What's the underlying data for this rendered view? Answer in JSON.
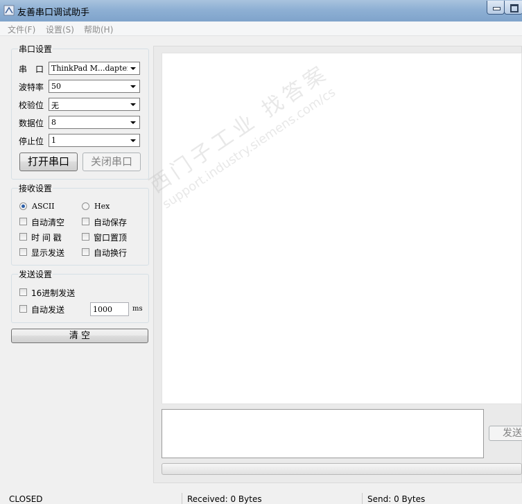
{
  "window": {
    "title": "友善串口调试助手"
  },
  "menu": {
    "items": [
      "文件(F)",
      "设置(S)",
      "帮助(H)"
    ]
  },
  "serial_settings": {
    "title": "串口设置",
    "port_label": "串　口",
    "port_value": "ThinkPad M...dapter",
    "baud_label": "波特率",
    "baud_value": "50",
    "parity_label": "校验位",
    "parity_value": "无",
    "databits_label": "数据位",
    "databits_value": "8",
    "stopbits_label": "停止位",
    "stopbits_value": "1",
    "open_button": "打开串口",
    "close_button": "关闭串口"
  },
  "receive_settings": {
    "title": "接收设置",
    "ascii_label": "ASCII",
    "hex_label": "Hex",
    "selected_mode": "ASCII",
    "auto_clear": "自动清空",
    "auto_save": "自动保存",
    "timestamp": "时 间 戳",
    "window_top": "窗口置顶",
    "show_send": "显示发送",
    "auto_wrap": "自动换行"
  },
  "send_settings": {
    "title": "发送设置",
    "hex_send": "16进制发送",
    "auto_send": "自动发送",
    "interval_value": "1000",
    "interval_unit": "ms"
  },
  "clear_button": "清 空",
  "send_button": "发送",
  "watermark": {
    "line1": "西门子工业  找答案",
    "line2": "support.industry.siemens.com/cs"
  },
  "status": {
    "state": "CLOSED",
    "received": "Received: 0 Bytes",
    "send": "Send: 0 Bytes"
  }
}
